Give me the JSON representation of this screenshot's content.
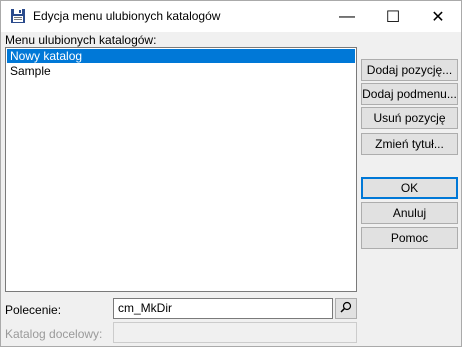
{
  "window": {
    "title": "Edycja menu ulubionych katalogów",
    "minimize_glyph": "—",
    "maximize_glyph": "☐",
    "close_glyph": "✕"
  },
  "list": {
    "label": "Menu ulubionych katalogów:",
    "items": [
      {
        "label": "Nowy katalog",
        "selected": true
      },
      {
        "label": "Sample",
        "selected": false
      }
    ]
  },
  "buttons": {
    "add_item": "Dodaj pozycję...",
    "add_submenu": "Dodaj podmenu...",
    "remove_item": "Usuń pozycję",
    "change_title": "Zmień tytuł...",
    "ok": "OK",
    "cancel": "Anuluj",
    "help": "Pomoc"
  },
  "fields": {
    "command_label": "Polecenie:",
    "command_value": "cm_MkDir",
    "target_label": "Katalog docelowy:",
    "target_value": ""
  },
  "colors": {
    "selection": "#0078d7",
    "default_button_border": "#0078d7"
  }
}
